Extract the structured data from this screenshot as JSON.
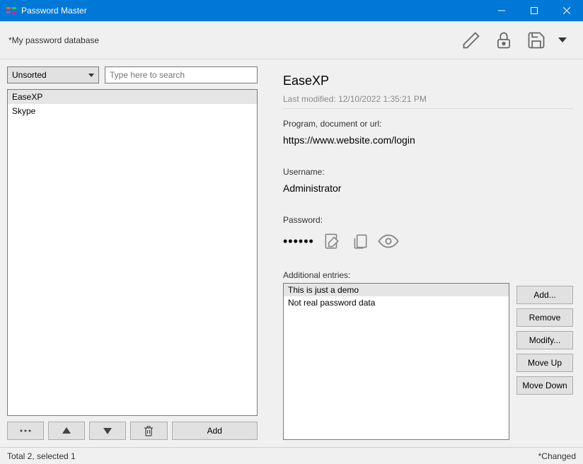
{
  "window": {
    "title": "Password Master"
  },
  "toolbar": {
    "db_name": "*My password database"
  },
  "sort": {
    "selected": "Unsorted"
  },
  "search": {
    "placeholder": "Type here to search"
  },
  "entries": [
    {
      "name": "EaseXP",
      "selected": true
    },
    {
      "name": "Skype",
      "selected": false
    }
  ],
  "left_buttons": {
    "add": "Add"
  },
  "detail": {
    "title": "EaseXP",
    "last_modified_label": "Last modified:",
    "last_modified_value": "12/10/2022 1:35:21 PM",
    "url_label": "Program, document or url:",
    "url_value": "https://www.website.com/login",
    "username_label": "Username:",
    "username_value": "Administrator",
    "password_label": "Password:",
    "password_mask": "••••••",
    "additional_label": "Additional entries:"
  },
  "additional_entries": [
    {
      "text": "This is just a demo",
      "selected": true
    },
    {
      "text": "Not real password data",
      "selected": false
    }
  ],
  "additional_buttons": {
    "add": "Add...",
    "remove": "Remove",
    "modify": "Modify...",
    "move_up": "Move Up",
    "move_down": "Move Down"
  },
  "statusbar": {
    "left": "Total 2, selected 1",
    "right": "*Changed"
  }
}
